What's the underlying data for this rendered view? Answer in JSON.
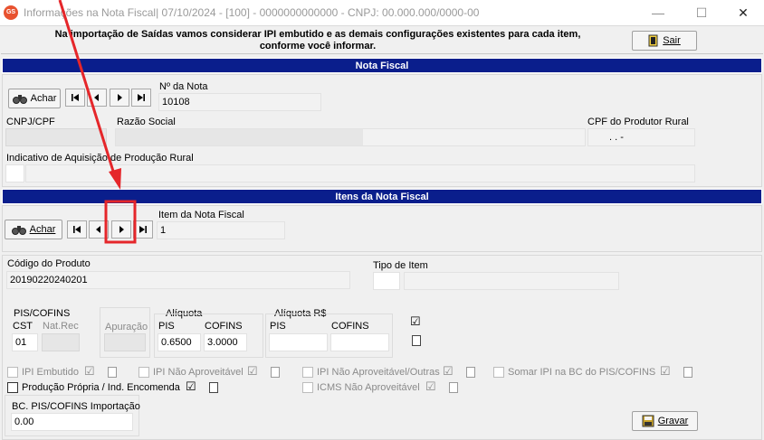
{
  "window": {
    "title": "Informações na Nota Fiscal|  07/10/2024 - [100] - 0000000000000 - CNPJ: 00.000.000/0000-00",
    "app_icon_text": "GS"
  },
  "info": {
    "line1": "Na importação de Saídas vamos considerar IPI embutido e as demais configurações existentes para cada item,",
    "line2": "conforme você informar.",
    "exit_label": "Sair"
  },
  "nota": {
    "section_title": "Nota Fiscal",
    "find_label": "Achar",
    "numero_label": "Nº da Nota",
    "numero_value": "10108",
    "cnpj_label": "CNPJ/CPF",
    "razao_label": "Razão Social",
    "cpf_produtor_label": "CPF do Produtor Rural",
    "cpf_produtor_value": ".   .   -",
    "indicativo_label": "Indicativo de Aquisição de Produção Rural"
  },
  "itens": {
    "section_title": "Itens da Nota Fiscal",
    "find_label": "Achar",
    "item_label": "Item da Nota Fiscal",
    "item_value": "1"
  },
  "produto": {
    "codigo_label": "Código do Produto",
    "codigo_value": "20190220240201",
    "tipo_label": "Tipo de Item"
  },
  "pis_cofins": {
    "group_label": "PIS/COFINS",
    "cst_label": "CST",
    "cst_value": "01",
    "natrec_label": "Nat.Rec",
    "apuracao_label": "Apuração",
    "aliquota_label": "Alíquota",
    "pis_label": "PIS",
    "pis_value": "0.6500",
    "cofins_label": "COFINS",
    "cofins_value": "3.0000",
    "aliquota_rs_label": "Alíquota R$",
    "pis_rs_label": "PIS",
    "cofins_rs_label": "COFINS"
  },
  "checks": {
    "ipi_embutido": "IPI Embutido",
    "ipi_nao_aproveitavel": "IPI Não Aproveitável",
    "ipi_nao_aproveitavel_outras": "IPI Não Aproveitável/Outras",
    "somar_ipi": "Somar IPI na BC do PIS/COFINS",
    "producao_propria": "Produção Própria / Ind. Encomenda",
    "icms_nao_aproveitavel": "ICMS Não Aproveitável"
  },
  "bc": {
    "label": "BC. PIS/COFINS Importação",
    "value": "0.00"
  },
  "save_label": "Gravar",
  "colors": {
    "section_bar": "#0a1e8c",
    "annotation_red": "#e5262a"
  }
}
